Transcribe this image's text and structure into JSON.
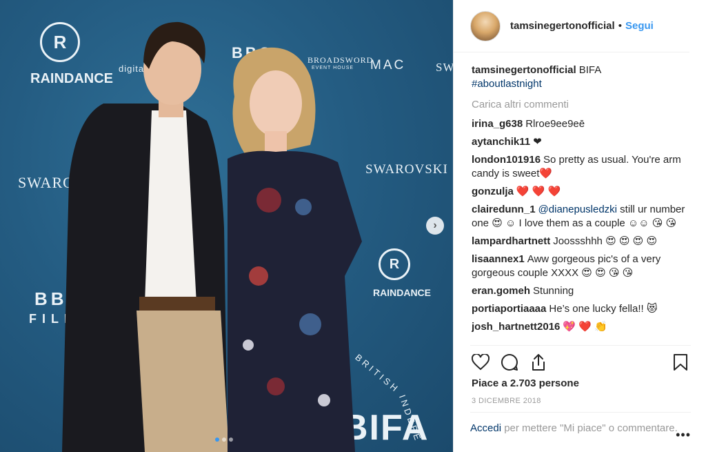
{
  "post": {
    "username": "tamsinegertonofficial",
    "separator": "•",
    "follow_label": "Segui",
    "caption_user": "tamsinegertonofficial",
    "caption_text": "BIFA",
    "caption_hashtag": "#aboutlastnight",
    "load_more_label": "Carica altri commenti",
    "comments": [
      {
        "user": "irina_g638",
        "text": "Rlroe9ee9eē"
      },
      {
        "user": "aytanchik11",
        "text": "❤"
      },
      {
        "user": "london101916",
        "text": "So pretty as usual. You're arm candy is sweet❤️"
      },
      {
        "user": "gonzulja",
        "text": "❤️ ❤️ ❤️"
      },
      {
        "user": "clairedunn_1",
        "mention": "@dianepusledzki",
        "text": " still ur number one 😍 ☺ I love them as a couple ☺☺ 😘 😘"
      },
      {
        "user": "lampardhartnett",
        "text": "Joossshhh 😍 😍 😍 😍"
      },
      {
        "user": "lisaannex1",
        "text": "Aww gorgeous pic's of a very gorgeous couple XXXX 😍 😍 😘 😘"
      },
      {
        "user": "eran.gomeh",
        "text": "Stunning"
      },
      {
        "user": "portiaportiaaaa",
        "text": "He’s one lucky fella!! 😻"
      },
      {
        "user": "josh_hartnett2016",
        "text": "💖 ❤️ 👏"
      }
    ],
    "likes_label": "Piace a 2.703 persone",
    "date_label": "3 DICEMBRE 2018",
    "footer_login": "Accedi",
    "footer_text": " per mettere \"Mi piace\" o commentare.",
    "more_label": "•••"
  },
  "photo": {
    "backdrop": {
      "raindance": "RAINDANCE",
      "digital": "digital cin",
      "bbc": "BBC",
      "broadsword": "BROADSWORD",
      "broadsword_sub": "EVENT HOUSE",
      "mac": "MAC",
      "sw": "SW",
      "swarovski": "SWAROVSKI",
      "bbc_films": "BBC",
      "films": "FILMS",
      "british": "BRITISH",
      "indep": "INDEPE",
      "bifa": "BIFA"
    },
    "carousel_total": 3,
    "carousel_active": 1
  },
  "icons": {
    "next": "chevron-right-icon",
    "like": "heart-icon",
    "comment": "comment-bubble-icon",
    "share": "share-icon",
    "save": "bookmark-icon"
  },
  "colors": {
    "accent": "#3897f0",
    "backdrop": "#245c82",
    "muted": "#999999",
    "link": "#003569"
  }
}
